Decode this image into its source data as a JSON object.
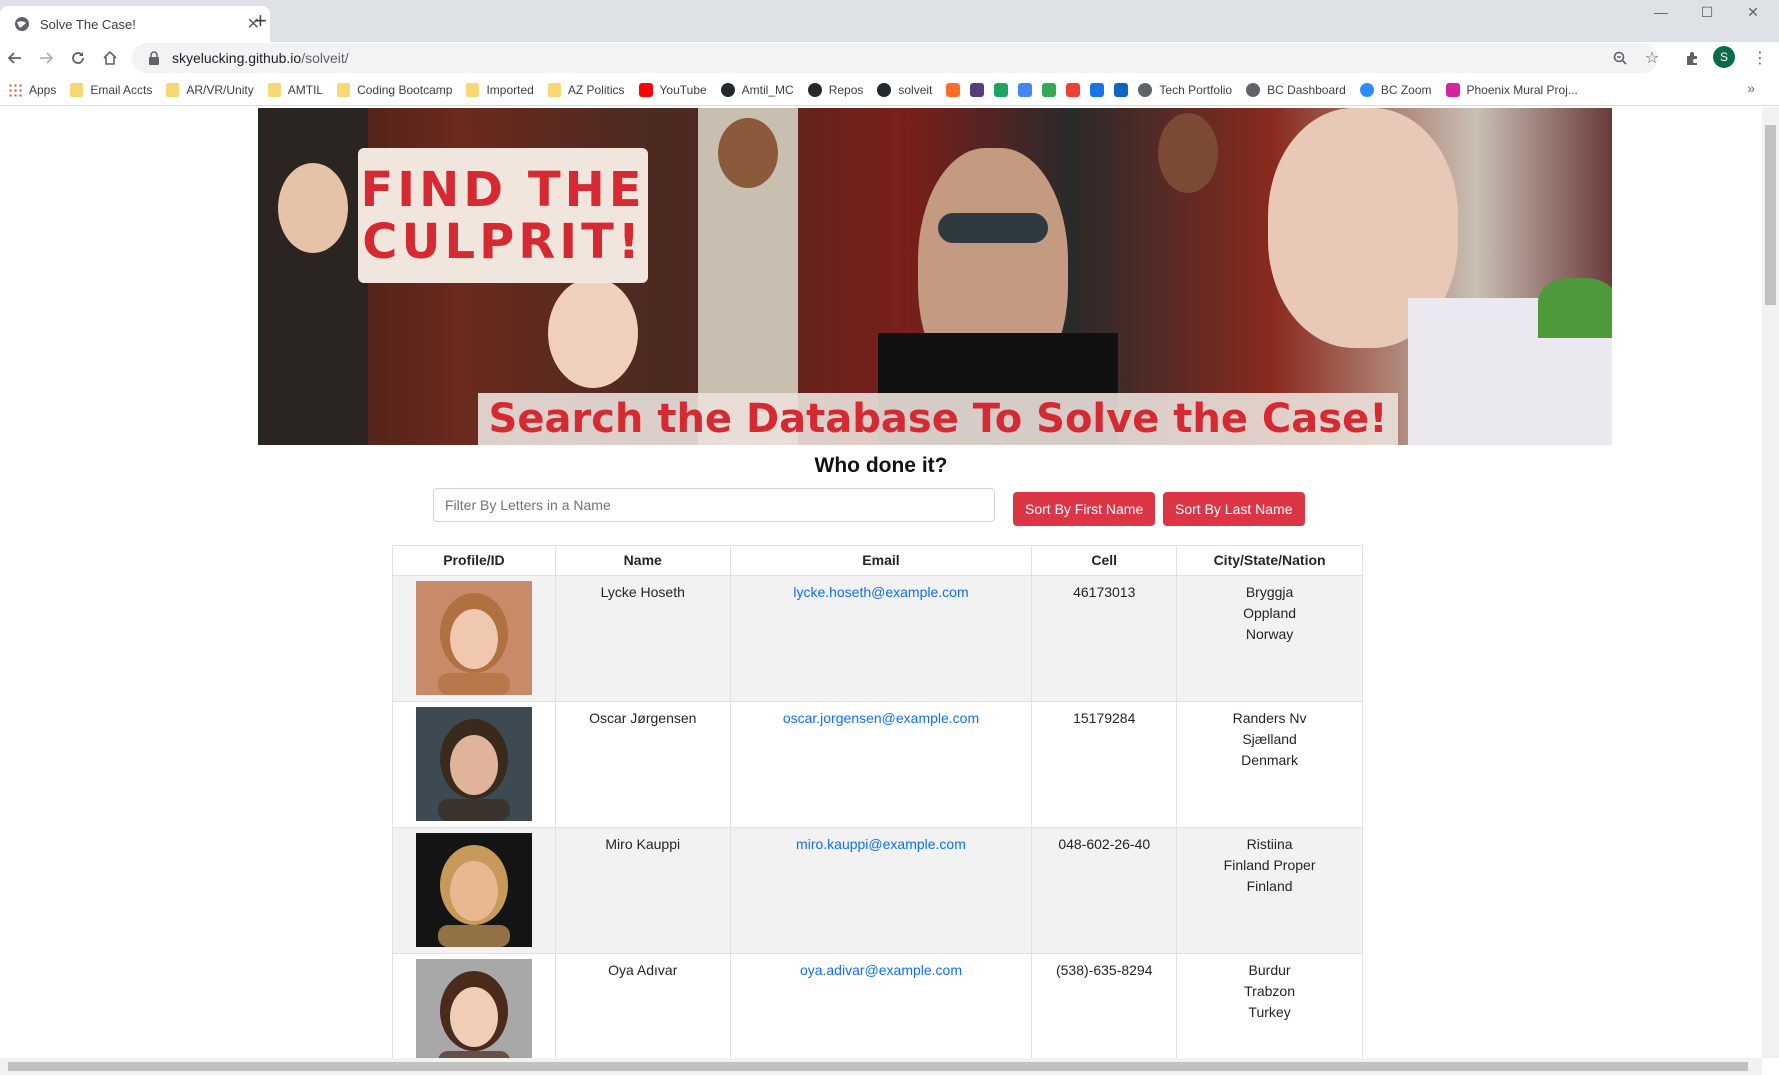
{
  "browser": {
    "tab_title": "Solve The Case!",
    "new_tab": "+",
    "url_host": "skyelucking.github.io",
    "url_path": "/solveit/",
    "profile_initial": "S",
    "bookmarks": [
      {
        "label": "Apps",
        "icon": "apps-grid-icon"
      },
      {
        "label": "Email Accts",
        "icon": "folder-icon"
      },
      {
        "label": "AR/VR/Unity",
        "icon": "folder-icon"
      },
      {
        "label": "AMTIL",
        "icon": "folder-icon"
      },
      {
        "label": "Coding Bootcamp",
        "icon": "folder-icon"
      },
      {
        "label": "Imported",
        "icon": "folder-icon"
      },
      {
        "label": "AZ Politics",
        "icon": "folder-icon"
      },
      {
        "label": "YouTube",
        "icon": "youtube-icon"
      },
      {
        "label": "Amtil_MC",
        "icon": "github-icon"
      },
      {
        "label": "Repos",
        "icon": "github-icon"
      },
      {
        "label": "solveit",
        "icon": "github-icon"
      },
      {
        "label": "",
        "icon": "gitlab-icon"
      },
      {
        "label": "",
        "icon": "bootstrap-icon"
      },
      {
        "label": "",
        "icon": "google-drive-icon"
      },
      {
        "label": "",
        "icon": "google-calendar-icon"
      },
      {
        "label": "",
        "icon": "google-maps-icon"
      },
      {
        "label": "",
        "icon": "gmail-icon"
      },
      {
        "label": "",
        "icon": "youtube-studio-icon"
      },
      {
        "label": "",
        "icon": "linkedin-icon"
      },
      {
        "label": "Tech Portfolio",
        "icon": "globe-icon"
      },
      {
        "label": "BC Dashboard",
        "icon": "globe-icon"
      },
      {
        "label": "BC Zoom",
        "icon": "zoom-icon"
      },
      {
        "label": "Phoenix Mural Proj...",
        "icon": "instagram-icon"
      }
    ],
    "bookmarks_more": "»"
  },
  "page": {
    "banner_sign_line1": "Find the",
    "banner_sign_line2": "Culprit!",
    "banner_strip": "Search the Database To Solve the Case!",
    "heading": "Who done it?",
    "filter_placeholder": "Filter By Letters in a Name",
    "sort_first": "Sort By First Name",
    "sort_last": "Sort By Last Name",
    "columns": [
      "Profile/ID",
      "Name",
      "Email",
      "Cell",
      "City/State/Nation"
    ],
    "rows": [
      {
        "name": "Lycke Hoseth",
        "email": "lycke.hoseth@example.com",
        "cell": "46173013",
        "city": "Bryggja",
        "state": "Oppland",
        "nation": "Norway",
        "photo_bg": "#c98a6a",
        "photo_hair": "#b07040",
        "photo_skin": "#f0c8b0"
      },
      {
        "name": "Oscar Jørgensen",
        "email": "oscar.jorgensen@example.com",
        "cell": "15179284",
        "city": "Randers Nv",
        "state": "Sjælland",
        "nation": "Denmark",
        "photo_bg": "#3d4a52",
        "photo_hair": "#3a2a1e",
        "photo_skin": "#e0b49a"
      },
      {
        "name": "Miro Kauppi",
        "email": "miro.kauppi@example.com",
        "cell": "048-602-26-40",
        "city": "Ristiina",
        "state": "Finland Proper",
        "nation": "Finland",
        "photo_bg": "#141414",
        "photo_hair": "#c89a5a",
        "photo_skin": "#e8b890"
      },
      {
        "name": "Oya Adıvar",
        "email": "oya.adivar@example.com",
        "cell": "(538)-635-8294",
        "city": "Burdur",
        "state": "Trabzon",
        "nation": "Turkey",
        "photo_bg": "#a8a8a8",
        "photo_hair": "#4a2a1a",
        "photo_skin": "#f0cdb5"
      }
    ]
  }
}
